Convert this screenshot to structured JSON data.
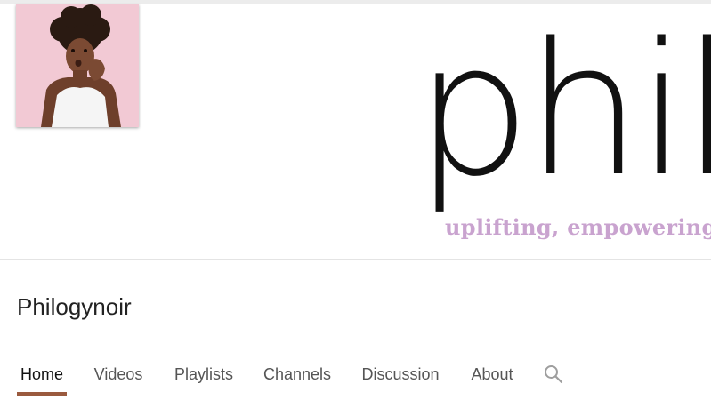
{
  "channel": {
    "name": "Philogynoir"
  },
  "banner": {
    "word": "philo",
    "tagline": "uplifting, empowering, +"
  },
  "tabs": [
    {
      "label": "Home",
      "active": true
    },
    {
      "label": "Videos",
      "active": false
    },
    {
      "label": "Playlists",
      "active": false
    },
    {
      "label": "Channels",
      "active": false
    },
    {
      "label": "Discussion",
      "active": false
    },
    {
      "label": "About",
      "active": false
    }
  ],
  "icons": {
    "tab_search": "search-icon"
  },
  "colors": {
    "active_tab_underline": "#9a5a3e",
    "tagline": "#c9a3cf",
    "avatar_background": "#f0c8d3"
  }
}
